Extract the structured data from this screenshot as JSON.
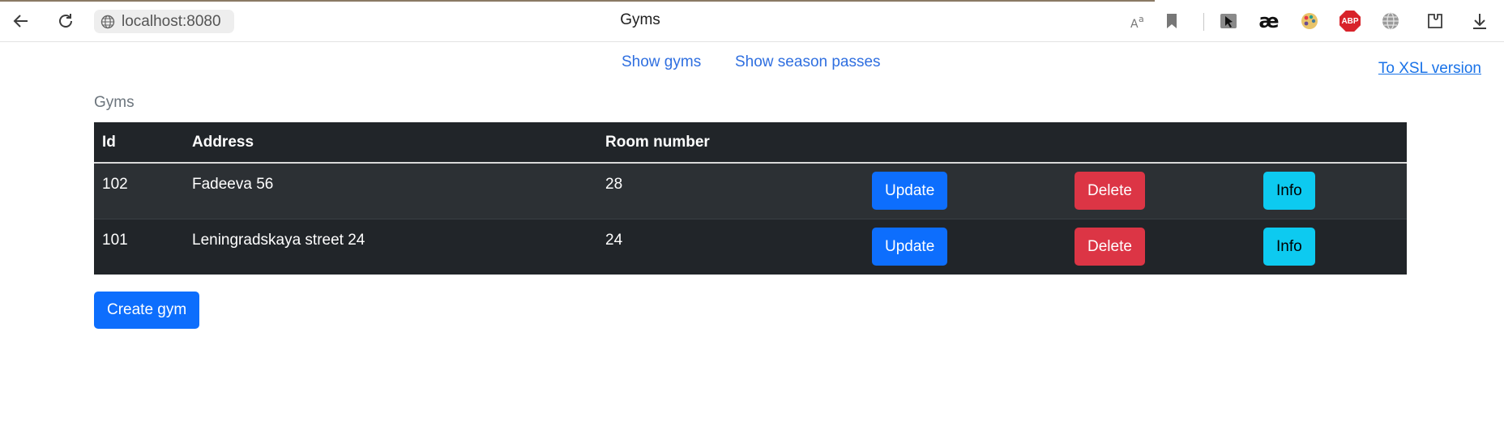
{
  "browser": {
    "url": "localhost:8080",
    "tab_title": "Gyms",
    "icons": [
      "back-icon",
      "reload-icon",
      "site-info-icon",
      "translate-icon",
      "bookmark-icon",
      "cursor-extension-icon",
      "ae-extension-icon",
      "palette-extension-icon",
      "adblock-extension-icon",
      "globe-extension-icon",
      "extensions-icon",
      "downloads-icon"
    ],
    "ae_label": "æ",
    "abp_label": "ABP"
  },
  "nav": {
    "show_gyms": "Show gyms",
    "show_season_passes": "Show season passes",
    "xsl_link": "To XSL version"
  },
  "table": {
    "caption": "Gyms",
    "headers": {
      "id": "Id",
      "address": "Address",
      "room": "Room number"
    },
    "rows": [
      {
        "id": "102",
        "address": "Fadeeva 56",
        "room": "28",
        "update": "Update",
        "delete": "Delete",
        "info": "Info"
      },
      {
        "id": "101",
        "address": "Leningradskaya street 24",
        "room": "24",
        "update": "Update",
        "delete": "Delete",
        "info": "Info"
      }
    ]
  },
  "create_button": "Create gym",
  "colors": {
    "primary": "#0d6efd",
    "danger": "#dc3545",
    "info": "#0dcaf0",
    "table_dark": "#212529",
    "table_stripe": "#2c3034",
    "link": "#2f6fe0"
  }
}
